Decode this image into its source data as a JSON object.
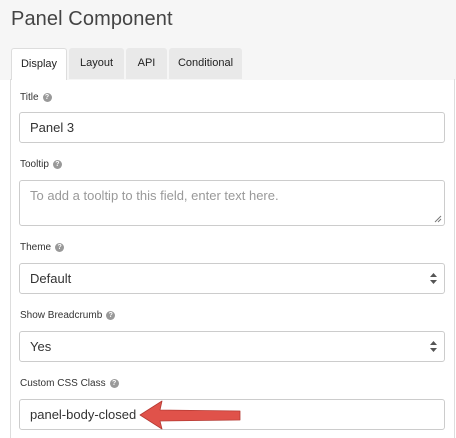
{
  "header": {
    "title": "Panel Component"
  },
  "tabs": [
    {
      "label": "Display",
      "active": true
    },
    {
      "label": "Layout",
      "active": false
    },
    {
      "label": "API",
      "active": false
    },
    {
      "label": "Conditional",
      "active": false
    }
  ],
  "fields": {
    "title": {
      "label": "Title",
      "value": "Panel 3"
    },
    "tooltip": {
      "label": "Tooltip",
      "placeholder": "To add a tooltip to this field, enter text here."
    },
    "theme": {
      "label": "Theme",
      "value": "Default"
    },
    "breadcrumb": {
      "label": "Show Breadcrumb",
      "value": "Yes"
    },
    "css_class": {
      "label": "Custom CSS Class",
      "value": "panel-body-closed"
    }
  },
  "help_glyph": "?",
  "colors": {
    "annotation_arrow": "#e0524a",
    "active_tab_bg": "#ffffff",
    "inactive_tab_bg": "#e9e9e9"
  }
}
